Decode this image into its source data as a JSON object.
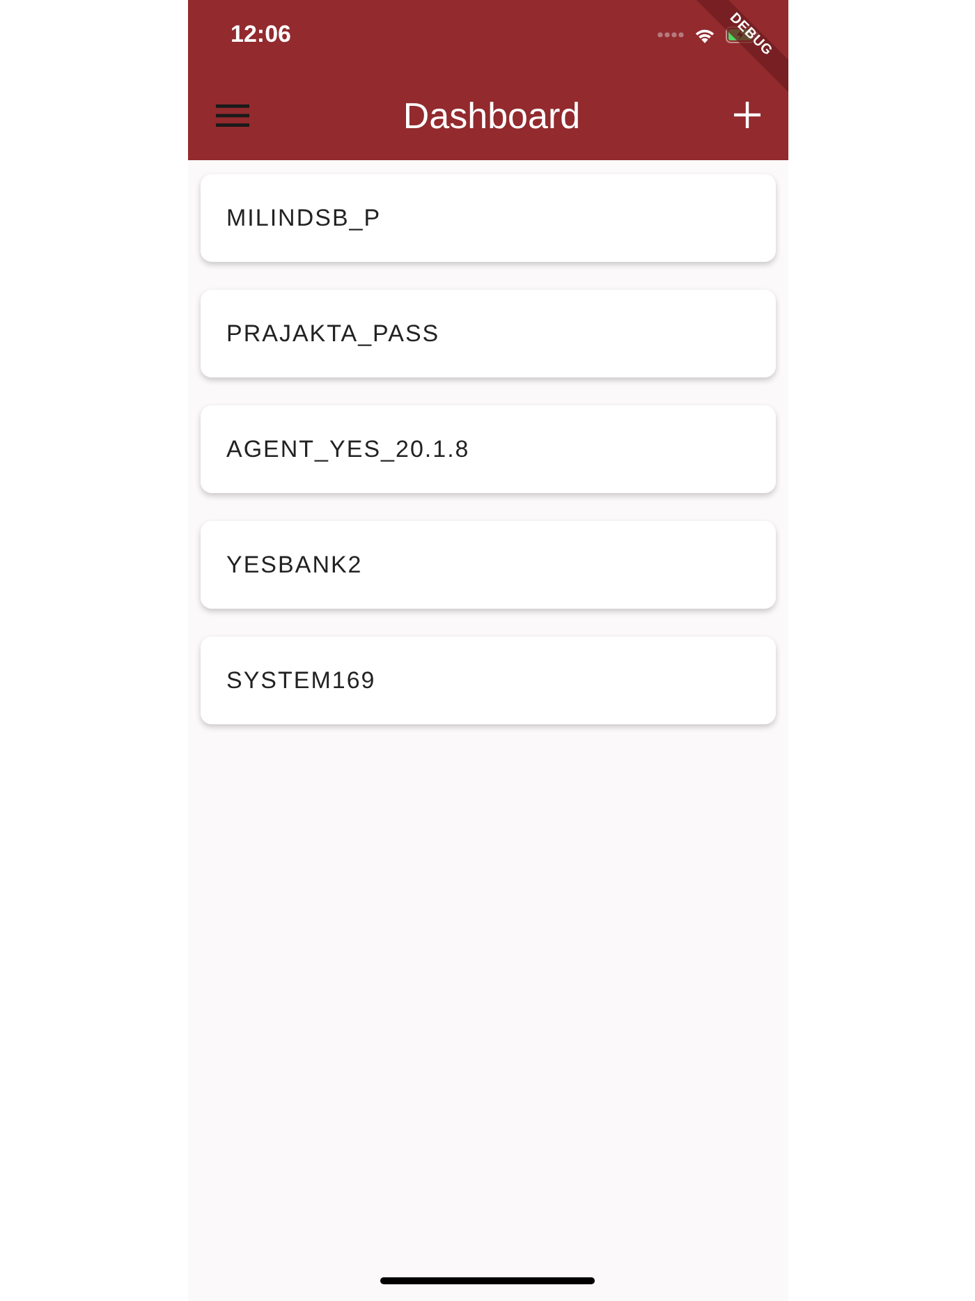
{
  "status_bar": {
    "time": "12:06"
  },
  "debug_banner": {
    "label": "DEBUG"
  },
  "app_bar": {
    "title": "Dashboard"
  },
  "items": [
    {
      "label": "MILINDSB_P"
    },
    {
      "label": "PRAJAKTA_PASS"
    },
    {
      "label": "AGENT_YES_20.1.8"
    },
    {
      "label": "YESBANK2"
    },
    {
      "label": "SYSTEM169"
    }
  ]
}
